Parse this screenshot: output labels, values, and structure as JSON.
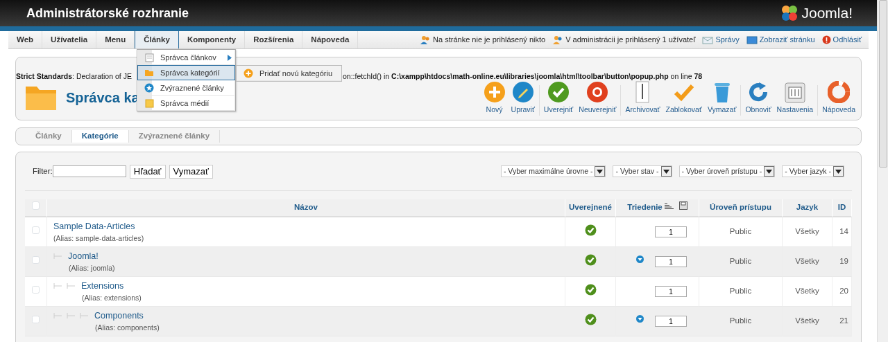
{
  "header": {
    "title": "Administrátorské rozhranie",
    "logo": "Joomla!"
  },
  "menu": [
    {
      "label": "Web",
      "selected": false
    },
    {
      "label": "Užívatelia",
      "selected": false
    },
    {
      "label": "Menu",
      "selected": false
    },
    {
      "label": "Články",
      "selected": true
    },
    {
      "label": "Komponenty",
      "selected": false
    },
    {
      "label": "Rozšírenia",
      "selected": false
    },
    {
      "label": "Nápoveda",
      "selected": false
    }
  ],
  "status": [
    {
      "kind": "users",
      "text": "Na stránke nie je prihlásený nikto",
      "link": false
    },
    {
      "kind": "admins",
      "text": "V administrácii je prihlásený 1 užívateľ",
      "link": false
    },
    {
      "kind": "messages",
      "text": "Správy",
      "link": true
    },
    {
      "kind": "site",
      "text": "Zobraziť stránku",
      "link": true
    },
    {
      "kind": "logout",
      "text": "Odhlásiť",
      "link": true
    }
  ],
  "dropdown": {
    "items": [
      {
        "kind": "articles",
        "label": "Správca článkov",
        "has_submenu": true,
        "selected": false
      },
      {
        "kind": "categories",
        "label": "Správca kategórií",
        "has_submenu": false,
        "selected": true
      },
      {
        "kind": "featured",
        "label": "Zvýraznené články",
        "has_submenu": false,
        "selected": false
      },
      {
        "kind": "media",
        "label": "Správca médií",
        "has_submenu": false,
        "selected": false
      }
    ],
    "submenu": [
      {
        "kind": "add",
        "label": "Pridať novú kategóriu"
      }
    ]
  },
  "notice": {
    "left": "**Strict Standards**: Declaration of JE",
    "right": "on::fetchId() in **C:\\xampp\\htdocs\\math-online.eu\\libraries\\joomla\\html\\toolbar\\button\\popup.php** on line **78**"
  },
  "page_title": "Správca ka",
  "toolbar": [
    {
      "kind": "new",
      "label": "Nový",
      "separator_before": false
    },
    {
      "kind": "edit",
      "label": "Upraviť",
      "separator_before": false
    },
    {
      "kind": "publish",
      "label": "Uverejniť",
      "separator_before": true
    },
    {
      "kind": "unpublish",
      "label": "Neuverejniť",
      "separator_before": false
    },
    {
      "kind": "archive",
      "label": "Archivovať",
      "separator_before": true
    },
    {
      "kind": "checkin",
      "label": "Zablokovať",
      "separator_before": false
    },
    {
      "kind": "trash",
      "label": "Vymazať",
      "separator_before": false
    },
    {
      "kind": "refresh",
      "label": "Obnoviť",
      "separator_before": true
    },
    {
      "kind": "options",
      "label": "Nastavenia",
      "separator_before": false
    },
    {
      "kind": "help",
      "label": "Nápoveda",
      "separator_before": true
    }
  ],
  "subtabs": [
    {
      "label": "Články",
      "selected": false
    },
    {
      "label": "Kategórie",
      "selected": true
    },
    {
      "label": "Zvýraznené články",
      "selected": false
    }
  ],
  "filter": {
    "label": "Filter:",
    "buttons": [
      "Hľadať",
      "Vymazať"
    ],
    "selects": [
      "- Vyber maximálne úrovne -",
      "- Vyber stav -",
      "- Vyber úroveň prístupu -",
      "- Vyber jazyk -"
    ]
  },
  "table": {
    "select_all_checked": false,
    "columns": [
      "Názov",
      "Uverejnené",
      "Triedenie",
      "Úroveň prístupu",
      "Jazyk",
      "ID"
    ],
    "rows": [
      {
        "title": "Sample Data-Articles",
        "alias": "(Alias: sample-data-articles)",
        "checked": false,
        "published": true,
        "move_down": false,
        "order": "1",
        "access": "Public",
        "language": "Všetky",
        "id": "14",
        "children": [
          {
            "title": "Joomla!",
            "alias": "(Alias: joomla)",
            "checked": false,
            "published": true,
            "move_down": true,
            "order": "1",
            "access": "Public",
            "language": "Všetky",
            "id": "19",
            "children": [
              {
                "title": "Extensions",
                "alias": "(Alias: extensions)",
                "checked": false,
                "published": true,
                "move_down": false,
                "order": "1",
                "access": "Public",
                "language": "Všetky",
                "id": "20",
                "children": [
                  {
                    "title": "Components",
                    "alias": "(Alias: components)",
                    "checked": false,
                    "published": true,
                    "move_down": true,
                    "order": "1",
                    "access": "Public",
                    "language": "Všetky",
                    "id": "21"
                  }
                ]
              }
            ]
          }
        ]
      }
    ]
  }
}
